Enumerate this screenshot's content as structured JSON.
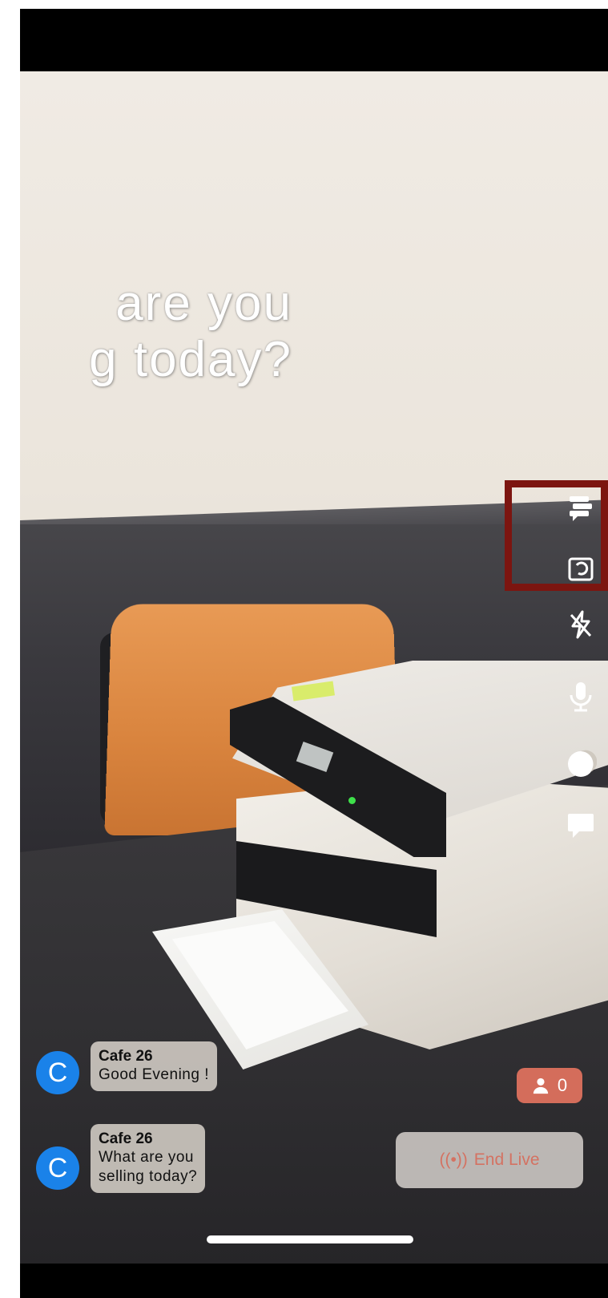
{
  "overlay": {
    "line1": "are  you",
    "line2": "g  today?"
  },
  "controls": [
    {
      "name": "comments-toggle-icon"
    },
    {
      "name": "flip-camera-icon"
    },
    {
      "name": "flash-off-icon"
    },
    {
      "name": "microphone-icon"
    },
    {
      "name": "beauty-filter-icon"
    },
    {
      "name": "chat-message-icon"
    }
  ],
  "viewers": {
    "count": "0"
  },
  "end_live": {
    "label": "End Live",
    "icon_text": "((•))"
  },
  "chat": [
    {
      "avatar": "C",
      "name": "Cafe 26",
      "message": "Good  Evening  !"
    },
    {
      "avatar": "C",
      "name": "Cafe 26",
      "message_lines": [
        "What  are  you",
        "selling  today?"
      ]
    }
  ],
  "colors": {
    "highlight_border": "#7c1510",
    "avatar": "#1a82e9",
    "viewer_badge": "#d46d5b",
    "end_live_text": "#d47262"
  }
}
